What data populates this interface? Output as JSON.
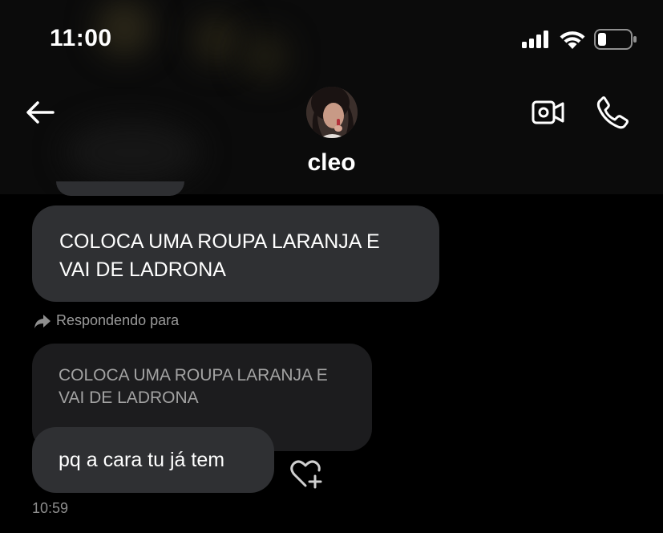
{
  "status_bar": {
    "time": "11:00",
    "signal_icon": "cellular-signal-icon",
    "wifi_icon": "wifi-icon",
    "battery_icon": "battery-icon"
  },
  "header": {
    "back_icon": "arrow-left-icon",
    "contact_name": "cleo",
    "video_icon": "video-camera-icon",
    "call_icon": "phone-icon"
  },
  "messages": [
    {
      "text": "COLOCA UMA ROUPA LARANJA E VAI DE LADRONA"
    }
  ],
  "reply": {
    "label": "Respondendo para",
    "icon": "reply-arrow-icon",
    "quoted_text": "COLOCA UMA ROUPA LARANJA E VAI DE LADRONA",
    "message_text": "pq a cara tu já tem",
    "react_icon": "heart-plus-icon",
    "time": "10:59"
  },
  "colors": {
    "background": "#000000",
    "bubble": "#2f3033",
    "quoted_bubble": "#1c1c1e",
    "muted_text": "#9a9a9a"
  }
}
